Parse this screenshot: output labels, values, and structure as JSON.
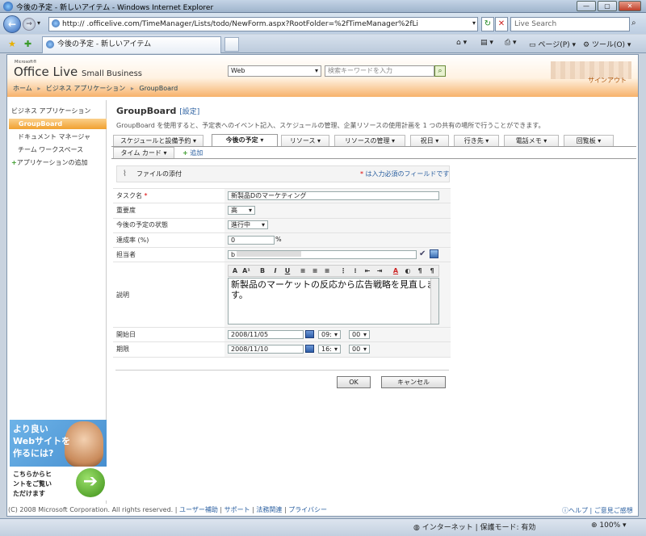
{
  "window": {
    "title": "今後の予定 - 新しいアイテム - Windows Internet Explorer"
  },
  "browser": {
    "address": "http://                .officelive.com/TimeManager/Lists/todo/NewForm.aspx?RootFolder=%2fTimeManager%2fLi",
    "live_search_placeholder": "Live Search",
    "tab_title": "今後の予定 - 新しいアイテム",
    "cmd_page": "ページ(P)",
    "cmd_tools": "ツール(O)"
  },
  "header": {
    "logo_small": "Microsoft®",
    "logo_main": "Office Live",
    "logo_sub": "Small Business",
    "search_scope": "Web",
    "search_placeholder": "検索キーワードを入力",
    "user_link": "サインアウト"
  },
  "breadcrumb": {
    "home": "ホーム",
    "apps": "ビジネス アプリケーション",
    "current": "GroupBoard"
  },
  "sidebar": {
    "heading": "ビジネス アプリケーション",
    "active": "GroupBoard",
    "items": [
      "ドキュメント マネージャ",
      "チーム ワークスペース"
    ],
    "add": "アプリケーションの追加"
  },
  "ad": {
    "headline": "より良い\nWebサイトを\n作るには?",
    "body": "こちらからヒ\nントをご覧い\nただけます"
  },
  "page": {
    "title": "GroupBoard",
    "settings": "[設定]",
    "description": "GroupBoard を使用すると、予定表へのイベント記入、スケジュールの管理、企業リソースの使用計画を 1 つの共有の場所で行うことができます。"
  },
  "tabs": {
    "row1": [
      "スケジュールと設備予約",
      "今後の予定",
      "リソース",
      "リソースの管理",
      "祝日",
      "行き先",
      "電話メモ",
      "回覧板"
    ],
    "row2": [
      "タイム カード"
    ],
    "add": "追加",
    "active": "今後の予定"
  },
  "form": {
    "attach": "ファイルの添付",
    "required_note": "は入力必須のフィールドです",
    "required_star": "*",
    "task_label": "タスク名",
    "task_value": "新製品Dのマーケティング",
    "priority_label": "重要度",
    "priority_value": "高",
    "status_label": "今後の予定の状態",
    "status_value": "進行中",
    "percent_label": "達成率 (%)",
    "percent_value": "0",
    "percent_unit": "%",
    "assigned_label": "担当者",
    "assigned_value": "b",
    "desc_label": "説明",
    "desc_value": "新製品のマーケットの反応から広告戦略を見直します。",
    "start_label": "開始日",
    "start_date": "2008/11/05",
    "start_hour": "09:",
    "start_min": "00",
    "due_label": "期限",
    "due_date": "2008/11/10",
    "due_hour": "16:",
    "due_min": "00",
    "ok": "OK",
    "cancel": "キャンセル"
  },
  "footer": {
    "copyright": "(C) 2008 Microsoft Corporation. All rights reserved.",
    "links": [
      "ユーザー補助",
      "サポート",
      "法務関連",
      "プライバシー"
    ],
    "help": "ヘルプ",
    "feedback": "ご意見ご感想"
  },
  "statusbar": {
    "zone": "インターネット | 保護モード: 有効",
    "zoom": "100%"
  }
}
